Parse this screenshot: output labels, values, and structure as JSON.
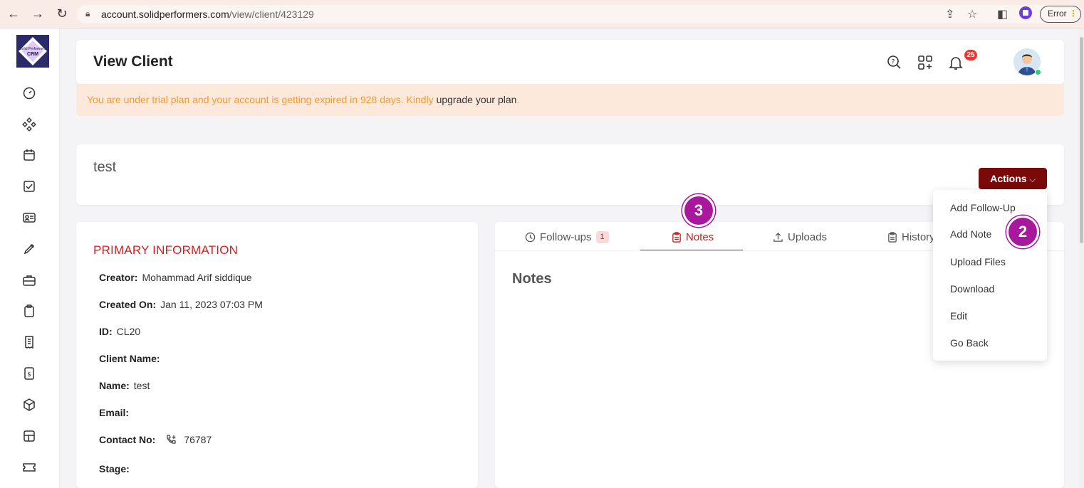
{
  "browser": {
    "url_host": "account.solidperformers.com",
    "url_path": "/view/client/423129",
    "error_label": "Error"
  },
  "sidebar": {
    "logo_text_top": "Solid Performers",
    "logo_text_bottom": "CRM",
    "icons": [
      "dashboard-icon",
      "integrations-icon",
      "calendar-icon",
      "tasks-icon",
      "contacts-icon",
      "leads-icon",
      "briefcase-icon",
      "clipboard-icon",
      "invoice-icon",
      "billing-icon",
      "products-icon",
      "layout-icon",
      "tickets-icon"
    ]
  },
  "header": {
    "title": "View Client",
    "notification_count": "25"
  },
  "banner": {
    "text": "You are under trial plan and your account is getting expired in 928 days. Kindly ",
    "link": "upgrade your plan",
    "suffix": "."
  },
  "client": {
    "name": "test",
    "actions_label": "Actions"
  },
  "info": {
    "title": "PRIMARY INFORMATION",
    "rows": [
      {
        "label": "Creator:",
        "value": "Mohammad Arif siddique"
      },
      {
        "label": "Created On:",
        "value": "Jan 11, 2023 07:03 PM"
      },
      {
        "label": "ID:",
        "value": "CL20"
      },
      {
        "label": "Client Name:",
        "value": ""
      },
      {
        "label": "Name:",
        "value": "test"
      },
      {
        "label": "Email:",
        "value": ""
      },
      {
        "label": "Contact No:",
        "value": "76787"
      },
      {
        "label": "Stage:",
        "value": ""
      }
    ]
  },
  "tabs": {
    "followups": "Follow-ups",
    "followups_count": "1",
    "notes": "Notes",
    "uploads": "Uploads",
    "history": "History"
  },
  "notes": {
    "heading": "Notes"
  },
  "dropdown": {
    "items": [
      "Add Follow-Up",
      "Add Note",
      "Upload Files",
      "Download",
      "Edit",
      "Go Back"
    ]
  },
  "steps": {
    "step_a": "3",
    "step_b": "2"
  }
}
